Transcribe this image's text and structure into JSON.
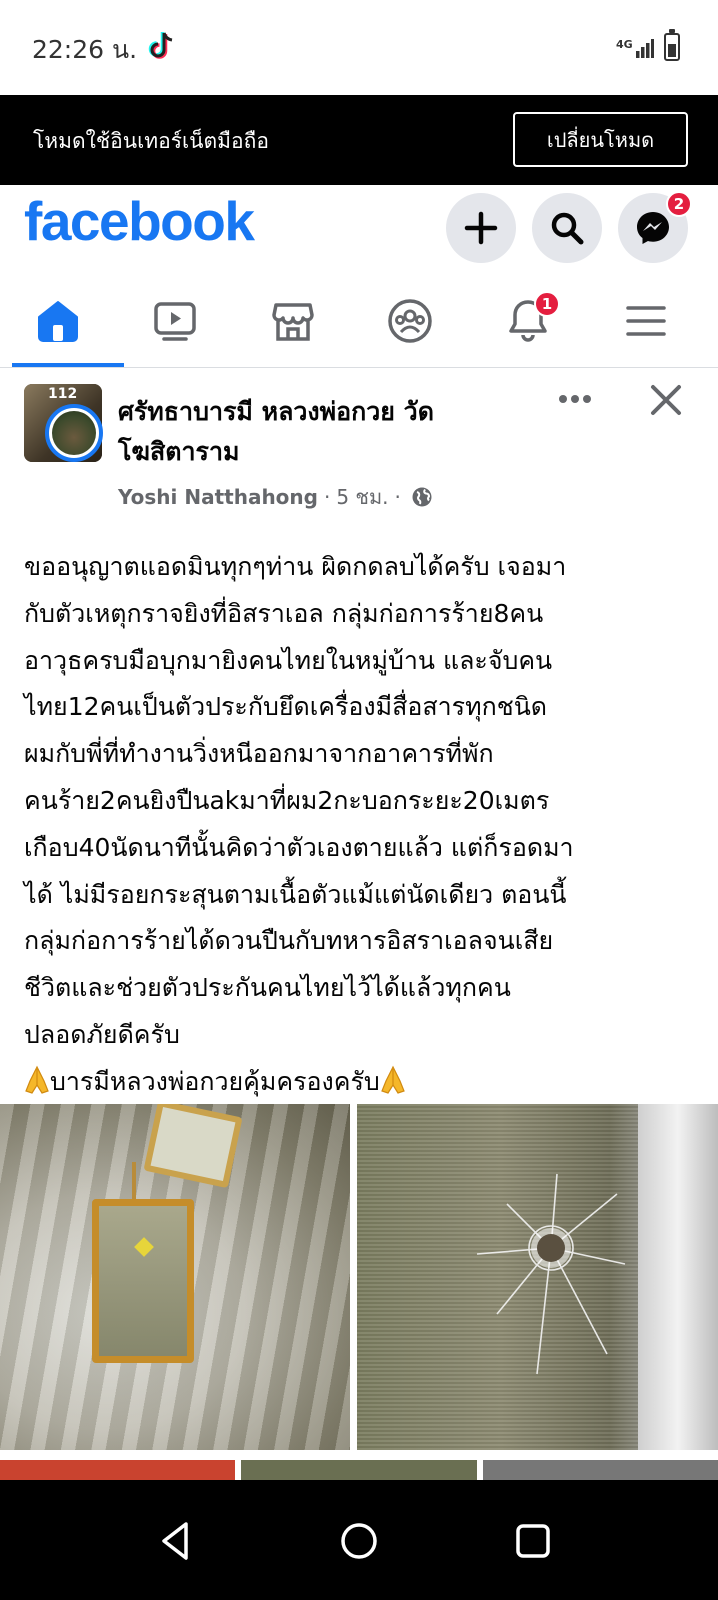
{
  "status_bar": {
    "time": "22:26 น.",
    "network": "4G",
    "icons": [
      "tiktok-icon",
      "signal-icon",
      "battery-icon"
    ]
  },
  "mode_banner": {
    "text": "โหมดใช้อินเทอร์เน็ตมือถือ",
    "button": "เปลี่ยนโหมด"
  },
  "header": {
    "logo": "facebook",
    "messenger_badge": "2",
    "colors": {
      "brand": "#1877f2",
      "badge": "#e41e3f"
    }
  },
  "nav": {
    "tabs": [
      "home",
      "watch",
      "marketplace",
      "groups",
      "notifications",
      "menu"
    ],
    "active": "home",
    "notifications_badge": "1"
  },
  "post": {
    "page_thumb_text": "112",
    "title": "ศรัทธาบารมี หลวงพ่อกวย วัดโฆสิตาราม",
    "title_line1": "ศรัทธาบารมี หลวงพ่อกวย วัด",
    "title_line2": "โฆสิตาราม",
    "author": "Yoshi Natthahong",
    "time": "5 ชม.",
    "sep": "·",
    "text_lines": [
      "ขออนุญาตแอดมินทุกๆท่าน ผิดกดลบได้ครับ เจอมา",
      "กับตัวเหตุกราจยิงที่อิสราเอล กลุ่มก่อการร้าย8คน",
      "อาวุธครบมือบุกมายิงคนไทยในหมู่บ้าน และจับคน",
      "ไทย12คนเป็นตัวประกับยึดเครื่องมีสื่อสารทุกชนิด",
      "ผมกับพี่ที่ทำงานวิ่งหนีออกมาจากอาคารที่พัก",
      "คนร้าย2คนยิงปืนakมาที่ผม2กะบอกระยะ20เมตร",
      "เกือบ40นัดนาทีนั้นคิดว่าตัวเองตายแล้ว แต่ก็รอดมา",
      "ได้ ไม่มีรอยกระสุนตามเนื้อตัวแม้แต่นัดเดียว ตอนนี้",
      "กลุ่มก่อการร้ายได้ดวนปืนกับทหารอิสราเอลจนเสีย",
      "ชีวิตและช่วยตัวประกันคนไทยไว้ได้แล้วทุกคน",
      "ปลอดภัยดีครับ"
    ],
    "last_line": "บารมีหลวงพ่อกวยคุ้มครองครับ",
    "photos": [
      "amulet-photo",
      "bullet-hole-window-photo"
    ]
  }
}
